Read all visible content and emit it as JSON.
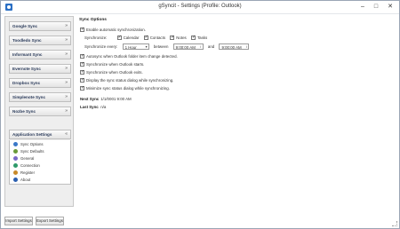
{
  "window": {
    "title": "gSyncit - Settings (Profile: Outlook)"
  },
  "sidebar": {
    "headers": [
      {
        "label": "Google Sync"
      },
      {
        "label": "Toodledo Sync"
      },
      {
        "label": "Informant Sync"
      },
      {
        "label": "Evernote Sync"
      },
      {
        "label": "Dropbox Sync"
      },
      {
        "label": "Simplenote Sync"
      },
      {
        "label": "Nozbe Sync"
      },
      {
        "label": "Application Settings"
      }
    ],
    "items": [
      {
        "label": "Sync Options",
        "icon": "sync-icon",
        "color": "#3a78c8"
      },
      {
        "label": "Sync Defaults",
        "icon": "defaults-icon",
        "color": "#6a9a3a"
      },
      {
        "label": "General",
        "icon": "general-icon",
        "color": "#7a6ac8"
      },
      {
        "label": "Connection",
        "icon": "connection-icon",
        "color": "#2e9a6a"
      },
      {
        "label": "Register",
        "icon": "register-icon",
        "color": "#c88a2a"
      },
      {
        "label": "About",
        "icon": "info-icon",
        "color": "#2b5fb0"
      }
    ]
  },
  "sync_options": {
    "title": "Sync Options",
    "enable_auto": "Enable automatic synchronization.",
    "synchronize_label": "Synchronize:",
    "types": [
      {
        "label": "Calendar",
        "checked": true
      },
      {
        "label": "Contacts",
        "checked": true
      },
      {
        "label": "Notes",
        "checked": true
      },
      {
        "label": "Tasks",
        "checked": true
      }
    ],
    "sync_every_label": "Synchronize every:",
    "interval": "1 Hour",
    "between_label": "between",
    "time_start": "9:00:00 AM",
    "and_label": "and",
    "time_end": "9:00:00 AM",
    "auto_item_change": "Autosync when Outlook folder item change detected.",
    "sync_on_start": "Synchronize when Outlook starts.",
    "sync_on_exit": "Synchronize when Outlook exits.",
    "display_status": "Display the sync status dialog while synchronizing.",
    "minimize_status": "Minimize sync status dialog while synchronizing.",
    "next_sync_label": "Next Sync",
    "next_sync_value": "1/1/0001 9:00 AM",
    "last_sync_label": "Last Sync",
    "last_sync_value": "n/a"
  },
  "footer": {
    "import_label": "Import Settings",
    "export_label": "Export Settings"
  }
}
